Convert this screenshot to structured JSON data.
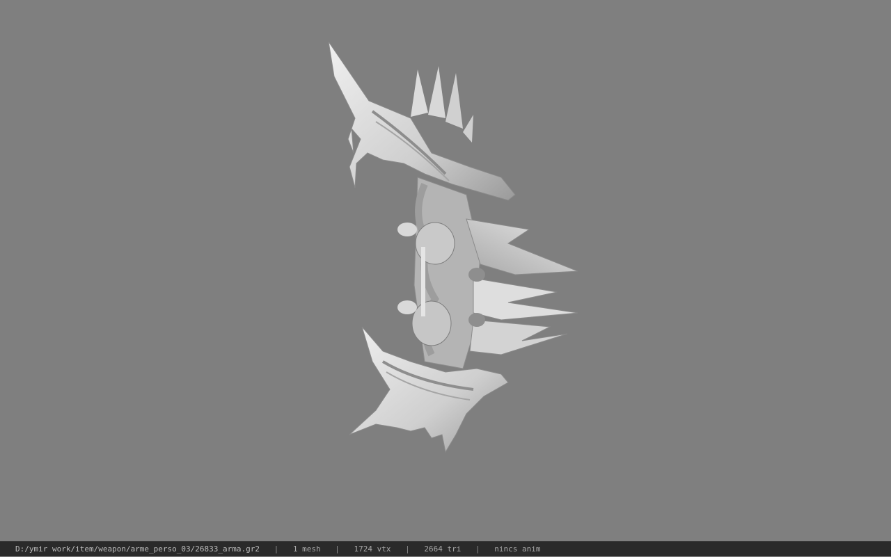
{
  "viewer": {
    "background_color": "#7f7f7f",
    "model_icon": "bow-weapon-model"
  },
  "status": {
    "path": "D:/ymir work/item/weapon/arme_perso_03/26833_arma.gr2",
    "separator": "|",
    "mesh": "1 mesh",
    "vtx": "1724 vtx",
    "tri": "2664 tri",
    "anim": "nincs anim"
  }
}
